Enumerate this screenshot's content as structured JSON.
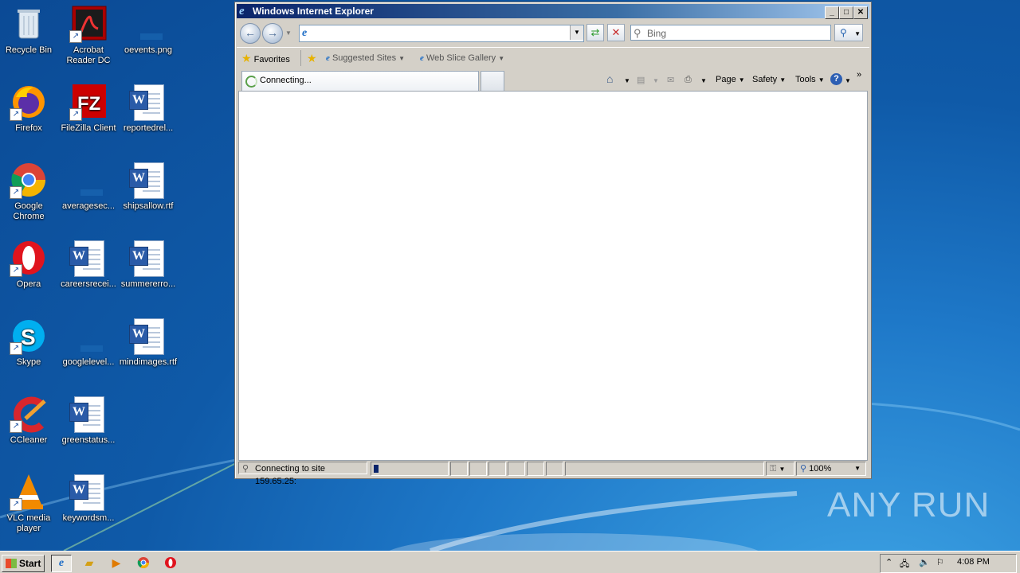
{
  "desktop": {
    "icons": [
      {
        "label": "Recycle Bin"
      },
      {
        "label": "Acrobat Reader DC"
      },
      {
        "label": "oevents.png"
      },
      {
        "label": "Firefox"
      },
      {
        "label": "FileZilla Client"
      },
      {
        "label": "reportedrel..."
      },
      {
        "label": "Google Chrome"
      },
      {
        "label": "averagesec..."
      },
      {
        "label": "shipsallow.rtf"
      },
      {
        "label": "Opera"
      },
      {
        "label": "careersrecei..."
      },
      {
        "label": "summererro..."
      },
      {
        "label": "Skype"
      },
      {
        "label": "googlelevel..."
      },
      {
        "label": "mindimages.rtf"
      },
      {
        "label": "CCleaner"
      },
      {
        "label": "greenstatus..."
      },
      {
        "label": "VLC media player"
      },
      {
        "label": "keywordsm..."
      }
    ]
  },
  "window": {
    "title": "Windows Internet Explorer",
    "search_placeholder": "Bing",
    "favorites": {
      "label": "Favorites",
      "suggested": "Suggested Sites",
      "gallery": "Web Slice Gallery"
    },
    "tab_label": "Connecting...",
    "commands": {
      "page": "Page",
      "safety": "Safety",
      "tools": "Tools"
    },
    "status_text": "Connecting to site 159.65.25:",
    "zoom": "100%",
    "progress_fraction": 0.02
  },
  "taskbar": {
    "start": "Start",
    "clock": "4:08 PM"
  },
  "watermark": "ANY  RUN"
}
